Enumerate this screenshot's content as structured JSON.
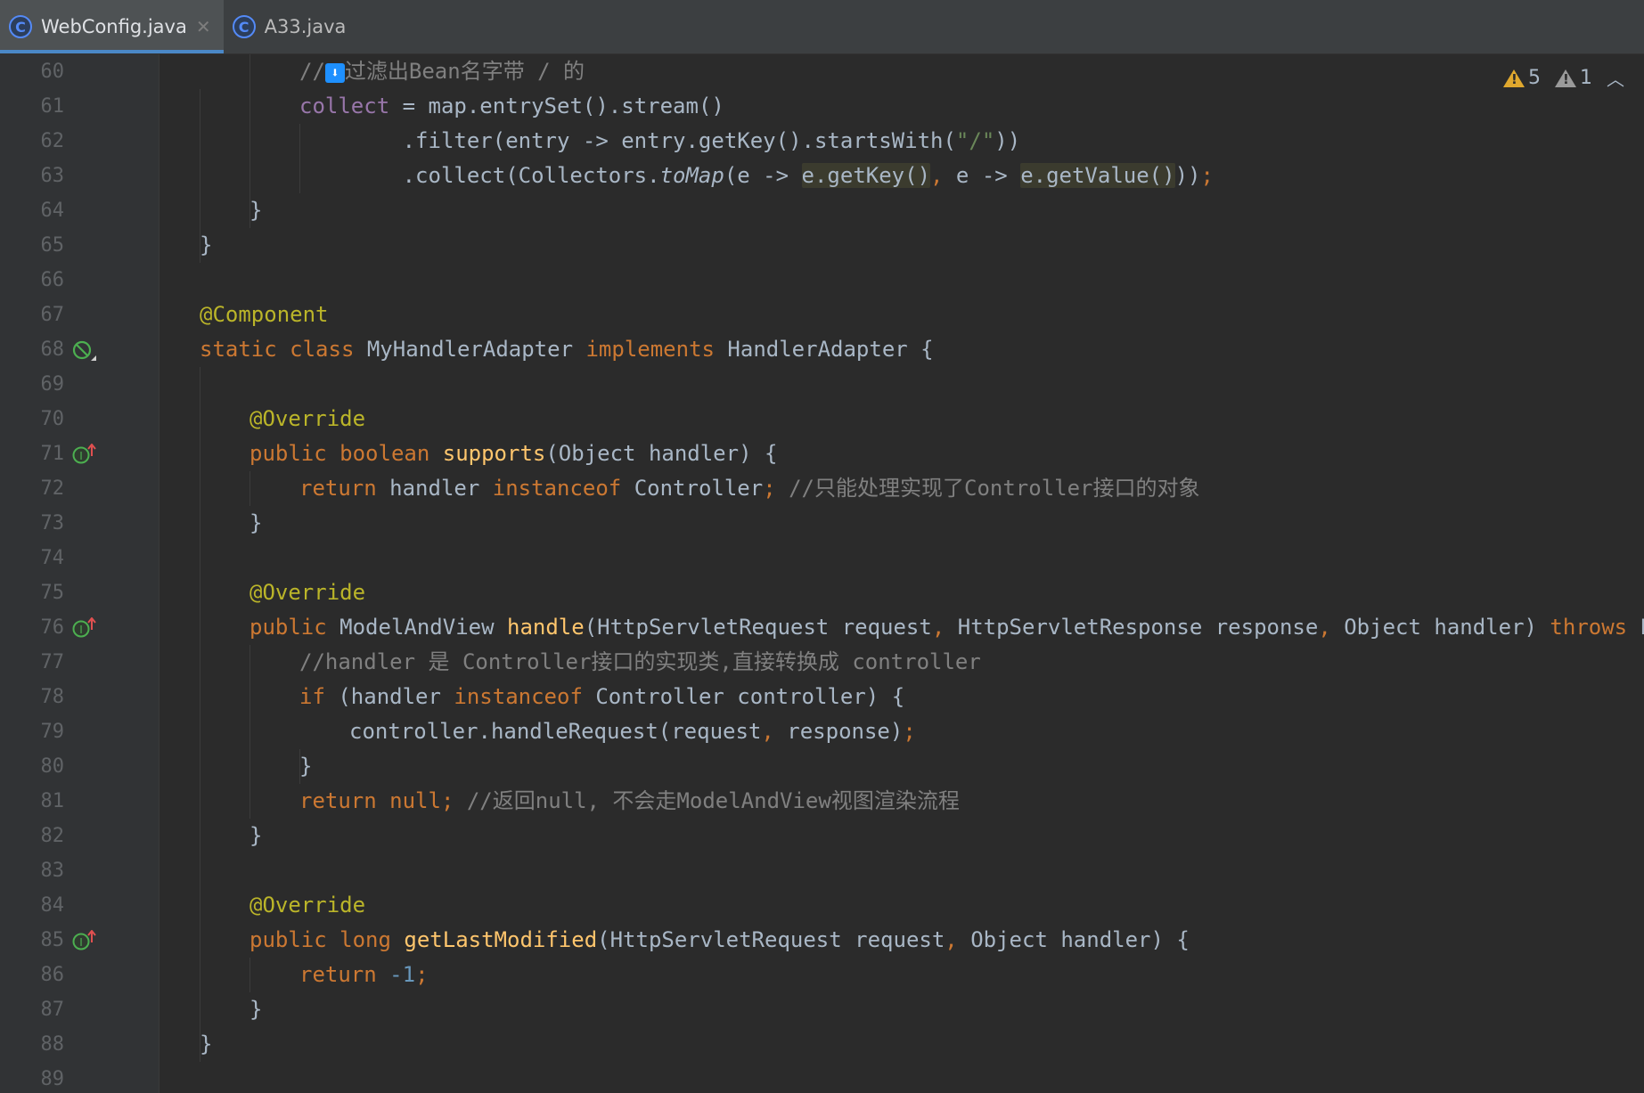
{
  "tabs": [
    {
      "label": "WebConfig.java",
      "icon": "class-icon",
      "active": true
    },
    {
      "label": "A33.java",
      "icon": "class-icon",
      "active": false
    }
  ],
  "inspections": {
    "warnings": "5",
    "weak_warnings": "1"
  },
  "lines": [
    {
      "n": "60",
      "g": "",
      "html": "<span class=\"cm\">//</span><span class=\"emoji\">⬇</span><span class=\"cm\">过滤出Bean名字带 / 的</span>"
    },
    {
      "n": "61",
      "g": "",
      "html": "<span class=\"fld\">collect</span> = map.entrySet().stream()"
    },
    {
      "n": "62",
      "g": "",
      "html": "        .filter(entry -> entry.getKey().startsWith(<span class=\"str\">\"/\"</span>))"
    },
    {
      "n": "63",
      "g": "",
      "html": "        .collect(Collectors.<span class=\"it\">toMap</span>(e -> <span class=\"hl\">e.getKey()</span><span class=\"kw\">,</span> e -> <span class=\"hl\">e.getValue()</span>))<span class=\"kw\">;</span>"
    },
    {
      "n": "64",
      "g": "",
      "html": "}"
    },
    {
      "n": "65",
      "g": "",
      "html": "}"
    },
    {
      "n": "66",
      "g": "",
      "html": ""
    },
    {
      "n": "67",
      "g": "",
      "html": "<span class=\"ann\">@Component</span>"
    },
    {
      "n": "68",
      "g": "bean",
      "html": "<span class=\"kw\">static class</span> MyHandlerAdapter <span class=\"kw\">implements</span> HandlerAdapter {"
    },
    {
      "n": "69",
      "g": "",
      "html": ""
    },
    {
      "n": "70",
      "g": "",
      "html": "<span class=\"ann\">@Override</span>"
    },
    {
      "n": "71",
      "g": "impl",
      "html": "<span class=\"kw\">public boolean</span> <span class=\"fn\">supports</span>(Object handler) {"
    },
    {
      "n": "72",
      "g": "",
      "html": "<span class=\"kw\">return</span> handler <span class=\"kw\">instanceof</span> Controller<span class=\"kw\">;</span> <span class=\"cm\">//只能处理实现了Controller接口的对象</span>"
    },
    {
      "n": "73",
      "g": "",
      "html": "}"
    },
    {
      "n": "74",
      "g": "",
      "html": ""
    },
    {
      "n": "75",
      "g": "",
      "html": "<span class=\"ann\">@Override</span>"
    },
    {
      "n": "76",
      "g": "impl",
      "html": "<span class=\"kw\">public</span> ModelAndView <span class=\"fn\">handle</span>(HttpServletRequest request<span class=\"kw\">,</span> HttpServletResponse response<span class=\"kw\">,</span> Object handler) <span class=\"kw\">throws</span> Exce"
    },
    {
      "n": "77",
      "g": "",
      "html": "<span class=\"cm\">//handler 是 Controller接口的实现类,直接转换成 controller</span>"
    },
    {
      "n": "78",
      "g": "",
      "html": "<span class=\"kw\">if</span> (handler <span class=\"kw\">instanceof</span> Controller controller) {"
    },
    {
      "n": "79",
      "g": "",
      "html": "controller.handleRequest(request<span class=\"kw\">,</span> response)<span class=\"kw\">;</span>"
    },
    {
      "n": "80",
      "g": "",
      "html": "}"
    },
    {
      "n": "81",
      "g": "",
      "html": "<span class=\"kw\">return null;</span> <span class=\"cm\">//返回null, 不会走ModelAndView视图渲染流程</span>"
    },
    {
      "n": "82",
      "g": "",
      "html": "}"
    },
    {
      "n": "83",
      "g": "",
      "html": ""
    },
    {
      "n": "84",
      "g": "",
      "html": "<span class=\"ann\">@Override</span>"
    },
    {
      "n": "85",
      "g": "impl",
      "html": "<span class=\"kw\">public long</span> <span class=\"fn\">getLastModified</span>(HttpServletRequest request<span class=\"kw\">,</span> Object handler) {"
    },
    {
      "n": "86",
      "g": "",
      "html": "<span class=\"kw\">return</span> <span class=\"num\">-1</span><span class=\"kw\">;</span>"
    },
    {
      "n": "87",
      "g": "",
      "html": "}"
    },
    {
      "n": "88",
      "g": "",
      "html": "}"
    },
    {
      "n": "89",
      "g": "",
      "html": ""
    }
  ]
}
